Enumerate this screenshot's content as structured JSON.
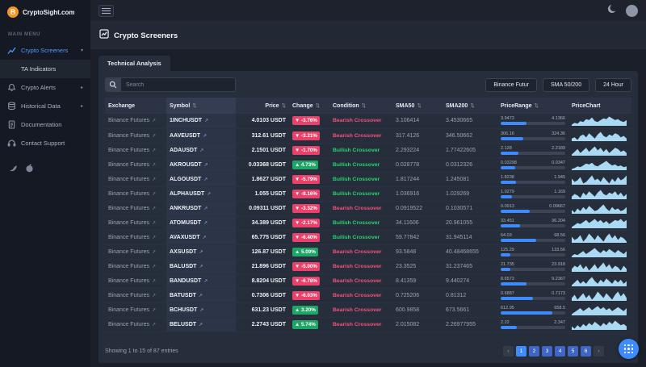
{
  "brand": {
    "name": "CryptoSight.com"
  },
  "sidebar": {
    "section": "MAIN MENU",
    "items": [
      {
        "label": "Crypto Screeners",
        "icon": "chart-icon",
        "active": true
      },
      {
        "label": "TA Indicators",
        "sub": true
      },
      {
        "label": "Crypto Alerts",
        "icon": "bell-icon"
      },
      {
        "label": "Historical Data",
        "icon": "database-icon"
      },
      {
        "label": "Documentation",
        "icon": "document-icon"
      },
      {
        "label": "Contact Support",
        "icon": "headset-icon"
      }
    ],
    "socials": [
      "twitter-icon",
      "reddit-icon"
    ]
  },
  "page": {
    "title": "Crypto Screeners"
  },
  "tab": {
    "label": "Technical Analysis"
  },
  "filters": {
    "search_placeholder": "Search",
    "buttons": [
      {
        "label": "Binance Futur"
      },
      {
        "label": "SMA 50/200"
      },
      {
        "label": "24 Hour"
      }
    ]
  },
  "table": {
    "sort_icon": "⇅",
    "columns": [
      {
        "label": "Exchange",
        "sort": false
      },
      {
        "label": "Symbol",
        "sort": true,
        "highlight": true
      },
      {
        "label": "Price",
        "sort": true,
        "align": "right"
      },
      {
        "label": "Change",
        "sort": true
      },
      {
        "label": "Condition",
        "sort": true
      },
      {
        "label": "SMA50",
        "sort": true
      },
      {
        "label": "SMA200",
        "sort": true
      },
      {
        "label": "PriceRange",
        "sort": true
      },
      {
        "label": "PriceChart",
        "sort": false
      }
    ],
    "rows": [
      {
        "exchange": "Binance Futures",
        "symbol": "1INCHUSDT",
        "price": "4.0103 USDT",
        "change": "-3.76%",
        "direction": "down",
        "condition": "Bearish Crossover",
        "trend": "bearish",
        "sma50": "3.106414",
        "sma200": "3.4530665",
        "range_low": "3.9473",
        "range_high": "4.1366",
        "range_pct": 40,
        "spark": [
          3,
          5,
          4,
          7,
          6,
          9,
          8,
          11,
          7,
          6,
          8,
          10,
          9,
          12,
          10,
          8,
          9,
          7,
          6,
          8
        ]
      },
      {
        "exchange": "Binance Futures",
        "symbol": "AAVEUSDT",
        "price": "312.61 USDT",
        "change": "-3.21%",
        "direction": "down",
        "condition": "Bearish Crossover",
        "trend": "bearish",
        "sma50": "317.4126",
        "sma200": "346.50662",
        "range_low": "306.16",
        "range_high": "324.36",
        "range_pct": 35,
        "spark": [
          6,
          7,
          5,
          8,
          9,
          7,
          10,
          8,
          6,
          9,
          11,
          8,
          7,
          9,
          8,
          10,
          9,
          7,
          8,
          6
        ]
      },
      {
        "exchange": "Binance Futures",
        "symbol": "ADAUSDT",
        "price": "2.1501 USDT",
        "change": "-1.70%",
        "direction": "down",
        "condition": "Bullish Crossover",
        "trend": "bullish",
        "sma50": "2.293224",
        "sma200": "1.77422605",
        "range_low": "2.128",
        "range_high": "2.2189",
        "range_pct": 28,
        "spark": [
          4,
          6,
          8,
          5,
          7,
          9,
          6,
          8,
          10,
          7,
          9,
          6,
          8,
          5,
          7,
          9,
          8,
          6,
          7,
          5
        ]
      },
      {
        "exchange": "Binance Futures",
        "symbol": "AKROUSDT",
        "price": "0.03368 USDT",
        "change": "4.73%",
        "direction": "up",
        "condition": "Bullish Crossover",
        "trend": "bullish",
        "sma50": "0.028778",
        "sma200": "0.0312326",
        "range_low": "0.03298",
        "range_high": "0.0347",
        "range_pct": 22,
        "spark": [
          2,
          3,
          5,
          4,
          6,
          8,
          7,
          9,
          6,
          5,
          7,
          9,
          11,
          8,
          6,
          7,
          5,
          6,
          4,
          5
        ]
      },
      {
        "exchange": "Binance Futures",
        "symbol": "ALGOUSDT",
        "price": "1.8627 USDT",
        "change": "-5.79%",
        "direction": "down",
        "condition": "Bullish Crossover",
        "trend": "bullish",
        "sma50": "1.817244",
        "sma200": "1.245081",
        "range_low": "1.8238",
        "range_high": "1.945",
        "range_pct": 24,
        "spark": [
          8,
          6,
          7,
          9,
          5,
          6,
          8,
          10,
          7,
          8,
          6,
          9,
          7,
          5,
          8,
          6,
          9,
          7,
          8,
          10
        ]
      },
      {
        "exchange": "Binance Futures",
        "symbol": "ALPHAUSDT",
        "price": "1.055 USDT",
        "change": "-8.16%",
        "direction": "down",
        "condition": "Bullish Crossover",
        "trend": "bullish",
        "sma50": "1.036916",
        "sma200": "1.029269",
        "range_low": "1.0279",
        "range_high": "1.169",
        "range_pct": 18,
        "spark": [
          5,
          7,
          6,
          4,
          8,
          6,
          9,
          7,
          5,
          8,
          10,
          7,
          6,
          8,
          7,
          9,
          6,
          8,
          5,
          7
        ]
      },
      {
        "exchange": "Binance Futures",
        "symbol": "ANKRUSDT",
        "price": "0.09311 USDT",
        "change": "-3.32%",
        "direction": "down",
        "condition": "Bearish Crossover",
        "trend": "bearish",
        "sma50": "0.0919522",
        "sma200": "0.1030571",
        "range_low": "0.0913",
        "range_high": "0.09667",
        "range_pct": 45,
        "spark": [
          7,
          5,
          8,
          6,
          9,
          7,
          10,
          8,
          6,
          7,
          9,
          11,
          8,
          6,
          9,
          7,
          8,
          6,
          7,
          9
        ]
      },
      {
        "exchange": "Binance Futures",
        "symbol": "ATOMUSDT",
        "price": "34.389 USDT",
        "change": "-2.17%",
        "direction": "down",
        "condition": "Bullish Crossover",
        "trend": "bullish",
        "sma50": "34.11606",
        "sma200": "20.961055",
        "range_low": "33.451",
        "range_high": "36.204",
        "range_pct": 30,
        "spark": [
          3,
          5,
          7,
          6,
          8,
          10,
          7,
          9,
          11,
          8,
          10,
          7,
          9,
          6,
          8,
          10,
          9,
          11,
          8,
          10
        ]
      },
      {
        "exchange": "Binance Futures",
        "symbol": "AVAXUSDT",
        "price": "65.775 USDT",
        "change": "-6.40%",
        "direction": "down",
        "condition": "Bullish Crossover",
        "trend": "bullish",
        "sma50": "59.77842",
        "sma200": "31.945114",
        "range_low": "64.03",
        "range_high": "68.56",
        "range_pct": 55,
        "spark": [
          9,
          7,
          8,
          10,
          6,
          8,
          11,
          9,
          7,
          10,
          8,
          6,
          9,
          11,
          8,
          10,
          7,
          9,
          8,
          6
        ]
      },
      {
        "exchange": "Binance Futures",
        "symbol": "AXSUSDT",
        "price": "126.87 USDT",
        "change": "5.09%",
        "direction": "up",
        "condition": "Bearish Crossover",
        "trend": "bearish",
        "sma50": "93.5848",
        "sma200": "40.48468655",
        "range_low": "125.29",
        "range_high": "133.56",
        "range_pct": 15,
        "spark": [
          4,
          6,
          5,
          7,
          9,
          6,
          8,
          10,
          12,
          9,
          7,
          10,
          8,
          11,
          9,
          7,
          10,
          8,
          6,
          9
        ]
      },
      {
        "exchange": "Binance Futures",
        "symbol": "BALUSDT",
        "price": "21.896 USDT",
        "change": "-5.00%",
        "direction": "down",
        "condition": "Bearish Crossover",
        "trend": "bearish",
        "sma50": "23.3525",
        "sma200": "31.237465",
        "range_low": "21.735",
        "range_high": "23.918",
        "range_pct": 15,
        "spark": [
          6,
          8,
          7,
          9,
          6,
          8,
          5,
          7,
          9,
          6,
          8,
          10,
          7,
          9,
          6,
          8,
          7,
          5,
          8,
          6
        ]
      },
      {
        "exchange": "Binance Futures",
        "symbol": "BANDUSDT",
        "price": "8.8204 USDT",
        "change": "-6.78%",
        "direction": "down",
        "condition": "Bearish Crossover",
        "trend": "bearish",
        "sma50": "8.41359",
        "sma200": "9.440274",
        "range_low": "8.6573",
        "range_high": "9.2367",
        "range_pct": 40,
        "spark": [
          5,
          7,
          9,
          6,
          8,
          6,
          9,
          11,
          8,
          6,
          9,
          7,
          10,
          8,
          6,
          9,
          7,
          9,
          6,
          8
        ]
      },
      {
        "exchange": "Binance Futures",
        "symbol": "BATUSDT",
        "price": "0.7306 USDT",
        "change": "-6.03%",
        "direction": "down",
        "condition": "Bearish Crossover",
        "trend": "bearish",
        "sma50": "0.725206",
        "sma200": "0.81312",
        "range_low": "0.6887",
        "range_high": "0.7173",
        "range_pct": 50,
        "spark": [
          7,
          9,
          6,
          8,
          10,
          7,
          9,
          6,
          8,
          11,
          9,
          7,
          10,
          8,
          6,
          9,
          11,
          8,
          10,
          7
        ]
      },
      {
        "exchange": "Binance Futures",
        "symbol": "BCHUSDT",
        "price": "631.23 USDT",
        "change": "3.20%",
        "direction": "up",
        "condition": "Bearish Crossover",
        "trend": "bearish",
        "sma50": "600.9858",
        "sma200": "673.5661",
        "range_low": "612.95",
        "range_high": "658.5",
        "range_pct": 80,
        "spark": [
          4,
          6,
          8,
          10,
          7,
          9,
          11,
          8,
          10,
          12,
          9,
          11,
          8,
          10,
          7,
          9,
          11,
          9,
          7,
          10
        ]
      },
      {
        "exchange": "Binance Futures",
        "symbol": "BELUSDT",
        "price": "2.2743 USDT",
        "change": "5.74%",
        "direction": "up",
        "condition": "Bearish Crossover",
        "trend": "bearish",
        "sma50": "2.015082",
        "sma200": "2.26977955",
        "range_low": "2.22",
        "range_high": "2.347",
        "range_pct": 25,
        "spark": [
          6,
          4,
          7,
          5,
          8,
          6,
          9,
          7,
          10,
          8,
          6,
          9,
          7,
          10,
          8,
          11,
          9,
          7,
          8,
          6
        ]
      }
    ]
  },
  "footer": {
    "showing": "Showing 1 to 15 of 87 entries",
    "prev": "‹",
    "next": "›",
    "pages": [
      "1",
      "2",
      "3",
      "4",
      "5",
      "6"
    ],
    "active_page": "1"
  },
  "colors": {
    "accent": "#3d8bfd",
    "down_badge": "#e8426b",
    "up_badge": "#1fa666",
    "bearish": "#f5527d",
    "bullish": "#2bd36f",
    "brand_coin": "#f7941e",
    "spark_fill": "#a9d9f3"
  }
}
